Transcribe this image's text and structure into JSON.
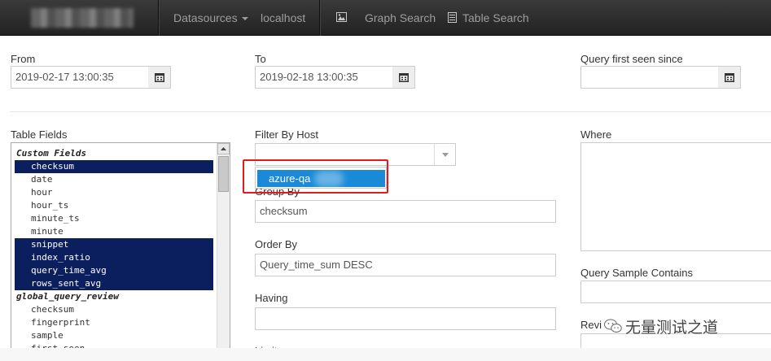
{
  "navbar": {
    "datasources_label": "Datasources",
    "host_label": "localhost",
    "graph_search_label": "Graph Search",
    "table_search_label": "Table Search"
  },
  "filters": {
    "from_label": "From",
    "from_value": "2019-02-17 13:00:35",
    "to_label": "To",
    "to_value": "2019-02-18 13:00:35",
    "first_seen_label": "Query first seen since",
    "first_seen_value": ""
  },
  "table_fields": {
    "label": "Table Fields",
    "groups": [
      {
        "name": "Custom Fields",
        "options": [
          {
            "text": "checksum",
            "selected": true
          },
          {
            "text": "date",
            "selected": false
          },
          {
            "text": "hour",
            "selected": false
          },
          {
            "text": "hour_ts",
            "selected": false
          },
          {
            "text": "minute_ts",
            "selected": false
          },
          {
            "text": "minute",
            "selected": false
          },
          {
            "text": "snippet",
            "selected": true
          },
          {
            "text": "index_ratio",
            "selected": true
          },
          {
            "text": "query_time_avg",
            "selected": true
          },
          {
            "text": "rows_sent_avg",
            "selected": true
          }
        ]
      },
      {
        "name": "global_query_review",
        "options": [
          {
            "text": "checksum",
            "selected": false
          },
          {
            "text": "fingerprint",
            "selected": false
          },
          {
            "text": "sample",
            "selected": false
          },
          {
            "text": "first_seen",
            "selected": false
          }
        ]
      }
    ]
  },
  "filter_by_host": {
    "label": "Filter By Host",
    "value": "",
    "dropdown_option": "azure-qa"
  },
  "group_by": {
    "label": "Group By",
    "value": "checksum"
  },
  "order_by": {
    "label": "Order By",
    "value": "Query_time_sum DESC"
  },
  "having": {
    "label": "Having",
    "value": ""
  },
  "limit": {
    "label": "Limit"
  },
  "where": {
    "label": "Where",
    "value": ""
  },
  "query_sample_contains": {
    "label": "Query Sample Contains",
    "value": ""
  },
  "reviewed_status": {
    "label": "Revi"
  },
  "watermark": {
    "text": "无量测试之道"
  },
  "colors": {
    "navbar_bg": "#222222",
    "selection_bg": "#0b1e5d",
    "dropdown_highlight": "#1a8ad8",
    "annotation_red": "#e21a1a"
  }
}
